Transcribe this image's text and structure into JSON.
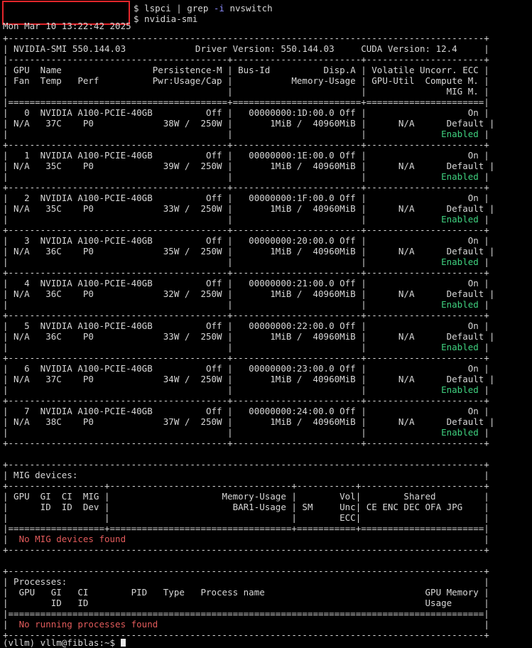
{
  "prompt": {
    "cmd1": "$ lspci | grep ",
    "cmd1_flag": "-i",
    "cmd1_tail": " nvswitch",
    "cmd2": "$ nvidia-smi"
  },
  "date_line": "Mon Mar 10 13:22:42 2025",
  "header": {
    "border": "+-----------------------------------------------------------------------------------------+",
    "info": "| NVIDIA-SMI 550.144.03             Driver Version: 550.144.03     CUDA Version: 12.4     |",
    "sep1": "|-----------------------------------------+------------------------+----------------------+",
    "col1": "| GPU  Name                 Persistence-M | Bus-Id          Disp.A | Volatile Uncorr. ECC |",
    "col2": "| Fan  Temp   Perf          Pwr:Usage/Cap |           Memory-Usage | GPU-Util  Compute M. |",
    "col3": "|                                         |                        |               MIG M. |",
    "eqsep": "|=========================================+========================+======================|"
  },
  "gpu_sep": "+-----------------------------------------+------------------------+----------------------+",
  "gpus": [
    {
      "l1": "|   0  NVIDIA A100-PCIE-40GB          Off |   00000000:1D:00.0 Off |                   On |",
      "l2": "| N/A   37C    P0             38W /  250W |       1MiB /  40960MiB |      N/A      Default |",
      "l3a": "|                                         |                        |              ",
      "mig": "Enabled",
      "l3b": " |"
    },
    {
      "l1": "|   1  NVIDIA A100-PCIE-40GB          Off |   00000000:1E:00.0 Off |                   On |",
      "l2": "| N/A   35C    P0             39W /  250W |       1MiB /  40960MiB |      N/A      Default |",
      "l3a": "|                                         |                        |              ",
      "mig": "Enabled",
      "l3b": " |"
    },
    {
      "l1": "|   2  NVIDIA A100-PCIE-40GB          Off |   00000000:1F:00.0 Off |                   On |",
      "l2": "| N/A   35C    P0             33W /  250W |       1MiB /  40960MiB |      N/A      Default |",
      "l3a": "|                                         |                        |              ",
      "mig": "Enabled",
      "l3b": " |"
    },
    {
      "l1": "|   3  NVIDIA A100-PCIE-40GB          Off |   00000000:20:00.0 Off |                   On |",
      "l2": "| N/A   36C    P0             35W /  250W |       1MiB /  40960MiB |      N/A      Default |",
      "l3a": "|                                         |                        |              ",
      "mig": "Enabled",
      "l3b": " |"
    },
    {
      "l1": "|   4  NVIDIA A100-PCIE-40GB          Off |   00000000:21:00.0 Off |                   On |",
      "l2": "| N/A   36C    P0             32W /  250W |       1MiB /  40960MiB |      N/A      Default |",
      "l3a": "|                                         |                        |              ",
      "mig": "Enabled",
      "l3b": " |"
    },
    {
      "l1": "|   5  NVIDIA A100-PCIE-40GB          Off |   00000000:22:00.0 Off |                   On |",
      "l2": "| N/A   36C    P0             33W /  250W |       1MiB /  40960MiB |      N/A      Default |",
      "l3a": "|                                         |                        |              ",
      "mig": "Enabled",
      "l3b": " |"
    },
    {
      "l1": "|   6  NVIDIA A100-PCIE-40GB          Off |   00000000:23:00.0 Off |                   On |",
      "l2": "| N/A   37C    P0             34W /  250W |       1MiB /  40960MiB |      N/A      Default |",
      "l3a": "|                                         |                        |              ",
      "mig": "Enabled",
      "l3b": " |"
    },
    {
      "l1": "|   7  NVIDIA A100-PCIE-40GB          Off |   00000000:24:00.0 Off |                   On |",
      "l2": "| N/A   38C    P0             37W /  250W |       1MiB /  40960MiB |      N/A      Default |",
      "l3a": "|                                         |                        |              ",
      "mig": "Enabled",
      "l3b": " |"
    }
  ],
  "mig": {
    "top": "+-----------------------------------------------------------------------------------------+",
    "title": "| MIG devices:                                                                            |",
    "sep": "+------------------+----------------------------------+-----------+-----------------------+",
    "h1": "| GPU  GI  CI  MIG |                     Memory-Usage |        Vol|        Shared         |",
    "h2": "|      ID  ID  Dev |                       BAR1-Usage | SM     Unc| CE ENC DEC OFA JPG    |",
    "h3": "|                  |                                  |        ECC|                       |",
    "eq": "|==================+==================================+===========+=======================|",
    "none_a": "|  ",
    "none_msg": "No MIG devices found",
    "none_b": "                                                                   |",
    "bottom": "+-----------------------------------------------------------------------------------------+"
  },
  "proc": {
    "top": "+-----------------------------------------------------------------------------------------+",
    "title": "| Processes:                                                                              |",
    "h1": "|  GPU   GI   CI        PID   Type   Process name                              GPU Memory |",
    "h2": "|        ID   ID                                                               Usage      |",
    "eq": "|=========================================================================================|",
    "none_a": "|  ",
    "none_msg": "No running processes found",
    "none_b": "                                                             |",
    "bottom": "+-----------------------------------------------------------------------------------------+"
  },
  "bottom_prompt": "(vllm) vllm@fiblas:~$ "
}
